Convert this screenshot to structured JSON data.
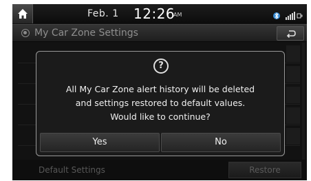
{
  "status_bar": {
    "home_icon": "home-icon",
    "date": "Feb.  1",
    "time": "12:26",
    "ampm": "AM",
    "icons": [
      "bluetooth-icon",
      "signal-icon"
    ]
  },
  "title_bar": {
    "title": "My Car Zone Settings",
    "back_icon": "back-arrow-icon"
  },
  "dialog": {
    "icon": "question-icon",
    "icon_glyph": "?",
    "lines": [
      "All My Car Zone alert history will be deleted",
      "and settings restored to default values.",
      "Would like to continue?"
    ],
    "yes_label": "Yes",
    "no_label": "No"
  },
  "footer": {
    "default_settings_label": "Default Settings",
    "restore_label": "Restore"
  },
  "colors": {
    "background": "#121212",
    "text": "#f0f0f0",
    "dialog_border": "#9a9a9a"
  }
}
